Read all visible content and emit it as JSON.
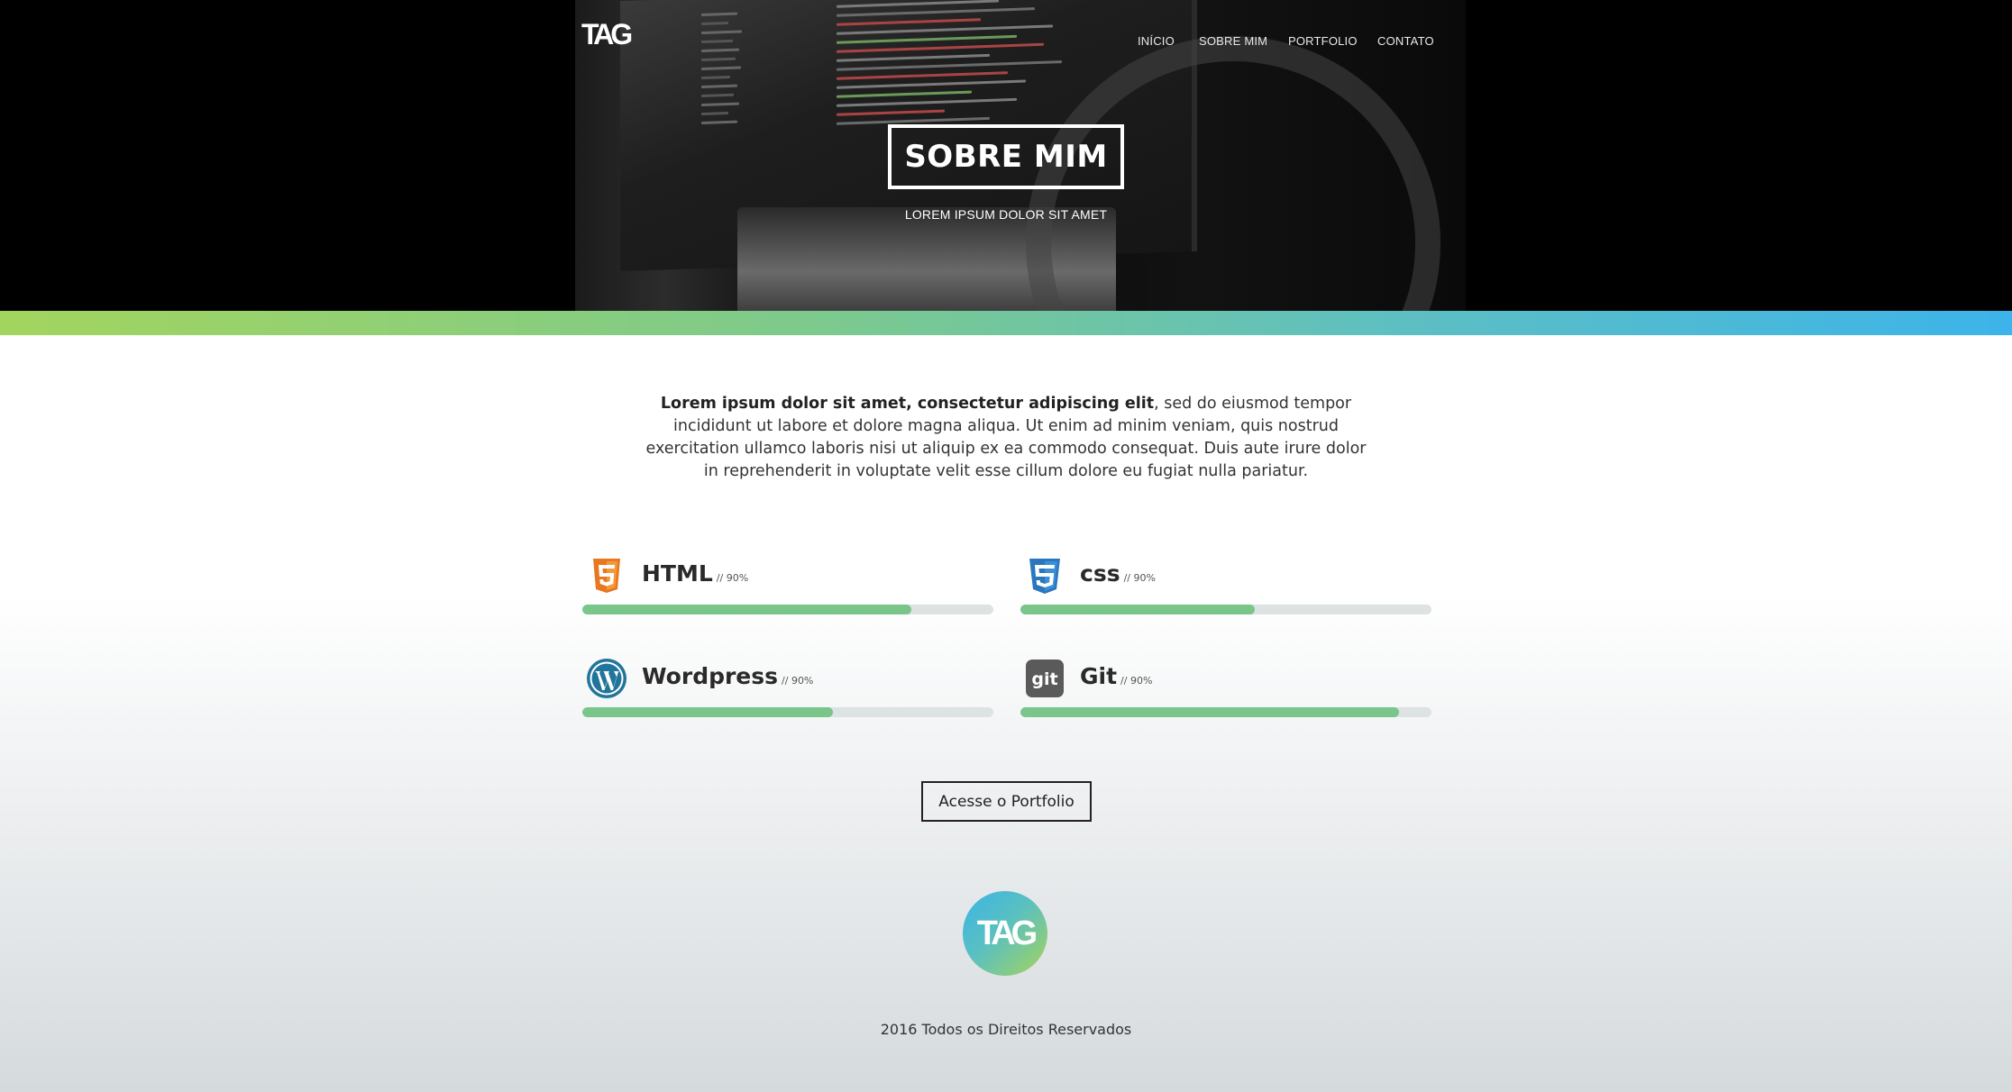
{
  "brand": {
    "logo_text": "TAG"
  },
  "nav": {
    "items": [
      {
        "label": "INÍCIO"
      },
      {
        "label": "SOBRE MIM"
      },
      {
        "label": "PORTFOLIO"
      },
      {
        "label": "CONTATO"
      }
    ]
  },
  "hero": {
    "title": "SOBRE MIM",
    "subtitle": "LOREM IPSUM DOLOR SIT AMET"
  },
  "intro": {
    "bold": "Lorem ipsum dolor sit amet, consectetur adipiscing elit",
    "rest": ", sed do eiusmod tempor incididunt ut labore et dolore magna aliqua. Ut enim ad minim veniam, quis nostrud exercitation ullamco laboris nisi ut aliquip ex ea commodo consequat. Duis aute irure dolor in reprehenderit in voluptate velit esse cillum dolore eu fugiat nulla pariatur."
  },
  "skills": [
    {
      "name": "HTML",
      "pct_label": "// 90%",
      "icon": "html5-icon",
      "fill": 0.8
    },
    {
      "name": "css",
      "pct_label": "// 90%",
      "icon": "css3-icon",
      "fill": 0.57
    },
    {
      "name": "Wordpress",
      "pct_label": "// 90%",
      "icon": "wordpress-icon",
      "fill": 0.61
    },
    {
      "name": "Git",
      "pct_label": "// 90%",
      "icon": "git-icon",
      "fill": 0.92
    }
  ],
  "cta": {
    "label": "Acesse o Portfolio"
  },
  "footer": {
    "logo_text": "TAG",
    "copyright": "2016 Todos os Direitos Reservados"
  },
  "colors": {
    "bar_green": "#a3d55e",
    "bar_blue": "#3cb3ea",
    "skill_fill": "#79c58a",
    "skill_track": "#dde2e3",
    "html_orange": "#e8771f",
    "css_blue": "#2a77bd",
    "wp_blue": "#21759b",
    "git_gray": "#5a5a5a"
  }
}
